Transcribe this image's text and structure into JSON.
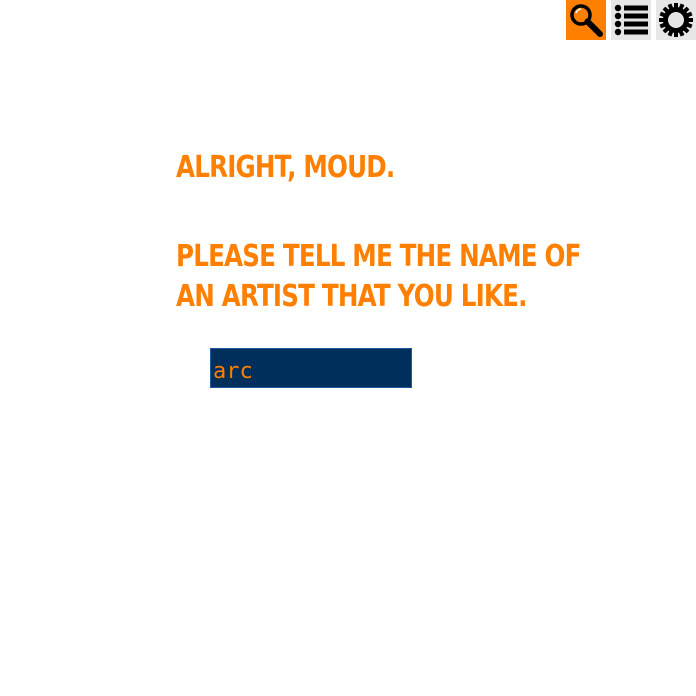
{
  "toolbar": {
    "search_icon": "search-icon",
    "menu_icon": "list-icon",
    "settings_icon": "gear-icon"
  },
  "main": {
    "greeting": "Alright, Moud.",
    "prompt_line1": "Please tell me the name of",
    "prompt_line2": "an artist that you like.",
    "artist_input_value": "arc"
  },
  "colors": {
    "accent": "#ff8000",
    "input_background": "#002f5c",
    "toolbar_button_background": "#e6e6e6"
  }
}
